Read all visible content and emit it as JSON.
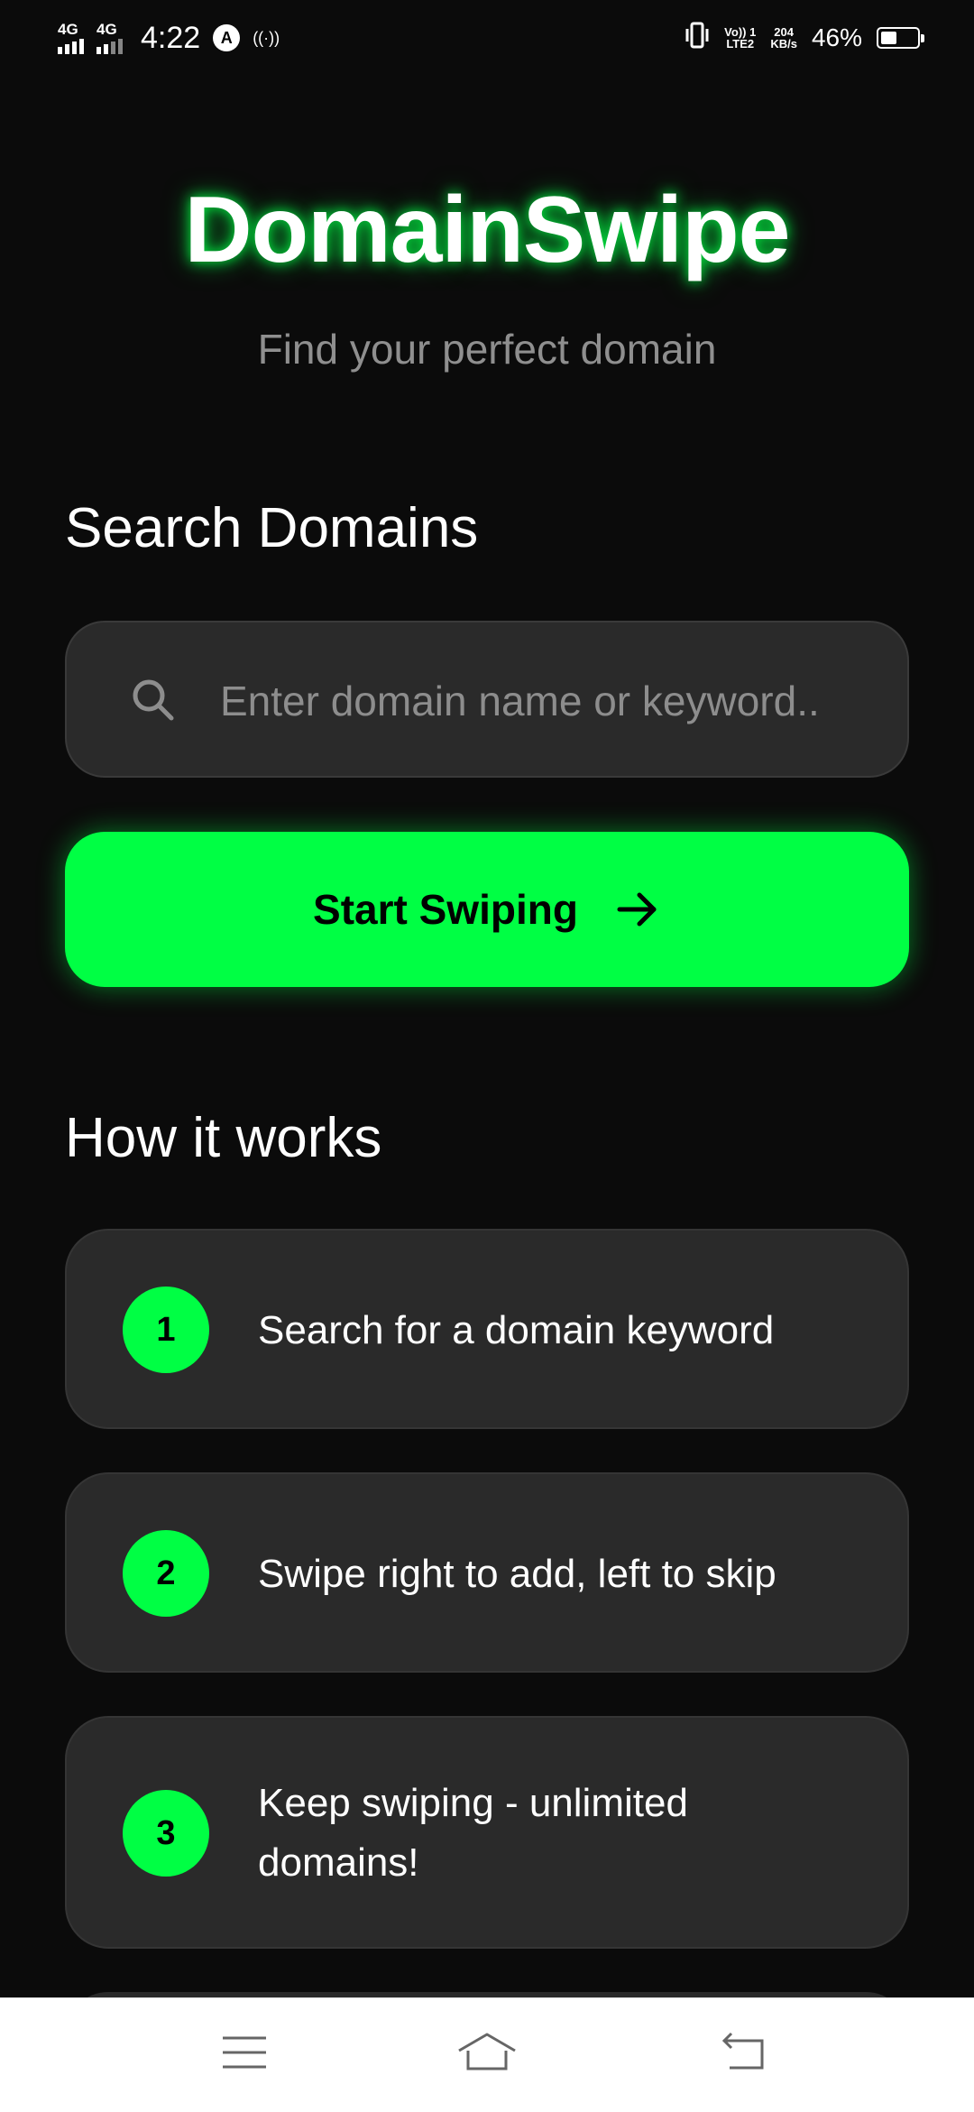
{
  "status_bar": {
    "sim1_network": "4G",
    "sim2_network": "4G",
    "time": "4:22",
    "app_badge": "A",
    "hotspot_label": "((·))",
    "volte_label": "Vo)) 1",
    "lte_label": "LTE2",
    "speed_value": "204",
    "speed_unit": "KB/s",
    "battery_percent": "46%",
    "battery_level": 0.46
  },
  "header": {
    "title": "DomainSwipe",
    "tagline": "Find your perfect domain",
    "accent_color": "#00ff44"
  },
  "search": {
    "heading": "Search Domains",
    "placeholder": "Enter domain name or keyword..",
    "value": ""
  },
  "start_button": {
    "label": "Start Swiping",
    "icon": "arrow-right-icon"
  },
  "how_it_works": {
    "heading": "How it works",
    "steps": [
      {
        "number": "1",
        "text": "Search for a domain keyword"
      },
      {
        "number": "2",
        "text": "Swipe right to add, left to skip"
      },
      {
        "number": "3",
        "text": "Keep swiping - unlimited domains!"
      }
    ]
  },
  "nav_bar": {
    "icons": [
      "menu-icon",
      "home-icon",
      "back-icon"
    ]
  }
}
